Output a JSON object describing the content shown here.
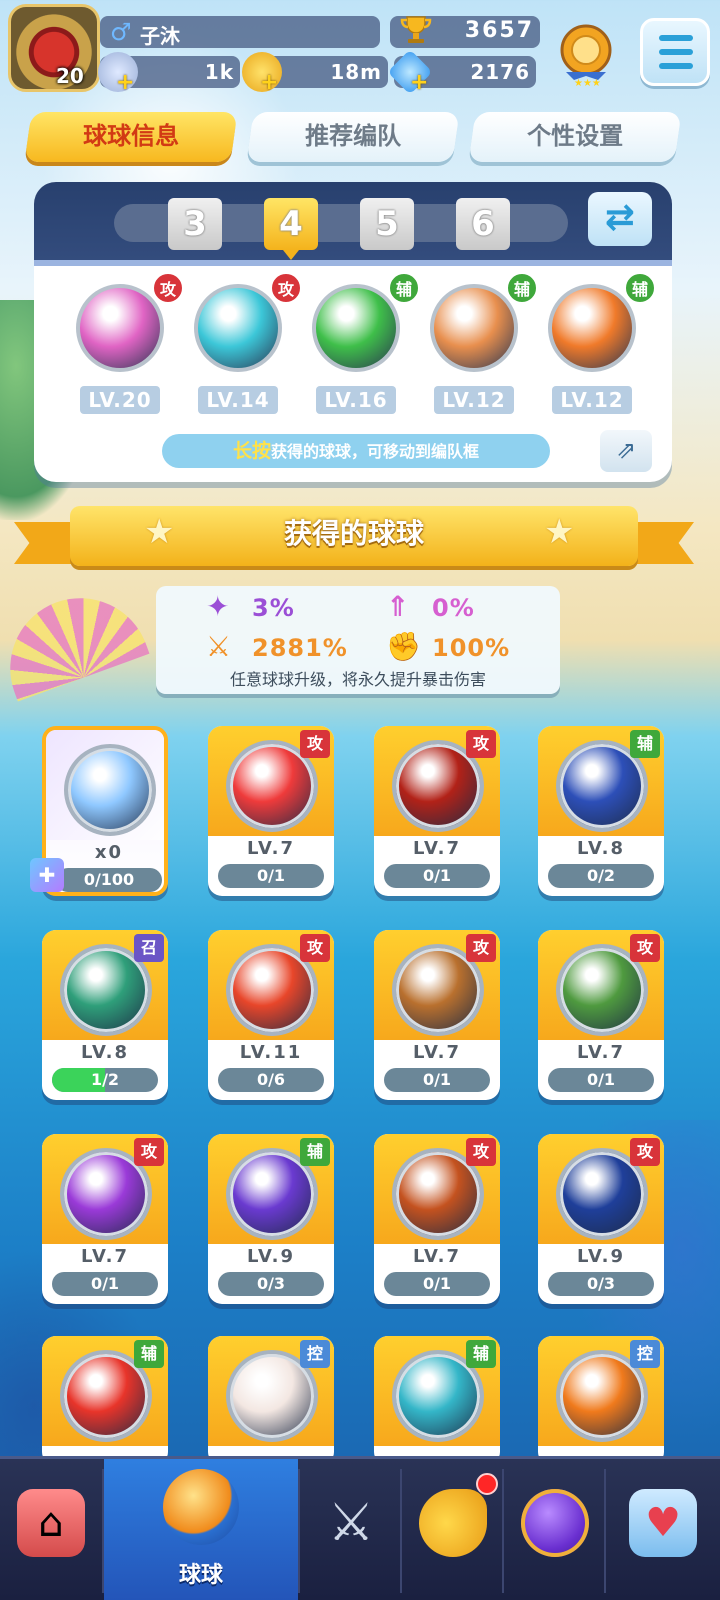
{
  "player": {
    "level": "20",
    "gender_icon": "male-icon",
    "name": "子沐",
    "trophies": "3657"
  },
  "resources": [
    {
      "icon": "star-energy-icon",
      "value": "1k"
    },
    {
      "icon": "gold-coin-icon",
      "value": "18m"
    },
    {
      "icon": "diamond-icon",
      "value": "2176"
    }
  ],
  "tabs": [
    {
      "label": "球球信息",
      "active": true
    },
    {
      "label": "推荐编队",
      "active": false
    },
    {
      "label": "个性设置",
      "active": false
    }
  ],
  "team": {
    "slots": [
      "3",
      "4",
      "5",
      "6"
    ],
    "active_slot": "4",
    "balls": [
      {
        "tag": "攻",
        "level": "LV.20",
        "color": "#e064c4"
      },
      {
        "tag": "攻",
        "level": "LV.14",
        "color": "#3cc7d8"
      },
      {
        "tag": "辅",
        "level": "LV.16",
        "color": "#3fbf4a"
      },
      {
        "tag": "辅",
        "level": "LV.12",
        "color": "#e88f4e"
      },
      {
        "tag": "辅",
        "level": "LV.12",
        "color": "#f07a2a"
      }
    ],
    "hint_highlight": "长按",
    "hint_text": "获得的球球，可移动到编队框"
  },
  "section_title": "获得的球球",
  "stats": {
    "items": [
      {
        "icon": "crit-rate-icon",
        "value": "3%",
        "color": "#9b4fd6"
      },
      {
        "icon": "crit-boost-icon",
        "value": "0%",
        "color": "#d65fd0"
      },
      {
        "icon": "crit-damage-icon",
        "value": "2881%",
        "color": "#f0922a"
      },
      {
        "icon": "power-icon",
        "value": "100%",
        "color": "#ec6a2a"
      }
    ],
    "note": "任意球球升级，将永久提升暴击伤害"
  },
  "cards": [
    {
      "special": true,
      "tag": "",
      "level": "x0",
      "progress": "0/100",
      "fill": 0,
      "color": "#8fc8ff"
    },
    {
      "tag": "攻",
      "level": "LV.7",
      "progress": "0/1",
      "fill": 0,
      "color": "#ef3b3b"
    },
    {
      "tag": "攻",
      "level": "LV.7",
      "progress": "0/1",
      "fill": 0,
      "color": "#b22218"
    },
    {
      "tag": "辅",
      "level": "LV.8",
      "progress": "0/2",
      "fill": 0,
      "color": "#2d4fb8"
    },
    {
      "tag": "召",
      "level": "LV.8",
      "progress": "1/2",
      "fill": 0.5,
      "color": "#2f9f7a"
    },
    {
      "tag": "攻",
      "level": "LV.11",
      "progress": "0/6",
      "fill": 0,
      "color": "#e8462a"
    },
    {
      "tag": "攻",
      "level": "LV.7",
      "progress": "0/1",
      "fill": 0,
      "color": "#b9702e"
    },
    {
      "tag": "攻",
      "level": "LV.7",
      "progress": "0/1",
      "fill": 0,
      "color": "#4f9a3f"
    },
    {
      "tag": "攻",
      "level": "LV.7",
      "progress": "0/1",
      "fill": 0,
      "color": "#9a3ad8"
    },
    {
      "tag": "辅",
      "level": "LV.9",
      "progress": "0/3",
      "fill": 0,
      "color": "#6a3ad0"
    },
    {
      "tag": "攻",
      "level": "LV.7",
      "progress": "0/1",
      "fill": 0,
      "color": "#c4521f"
    },
    {
      "tag": "攻",
      "level": "LV.9",
      "progress": "0/3",
      "fill": 0,
      "color": "#1f3f9a"
    },
    {
      "tag": "辅",
      "level": "",
      "progress": "",
      "fill": 0,
      "color": "#e8342a"
    },
    {
      "tag": "控",
      "level": "",
      "progress": "",
      "fill": 0,
      "color": "#f3e7e2"
    },
    {
      "tag": "辅",
      "level": "",
      "progress": "",
      "fill": 0,
      "color": "#34b6c8"
    },
    {
      "tag": "控",
      "level": "",
      "progress": "",
      "fill": 0,
      "color": "#f07a1c"
    }
  ],
  "nav": [
    {
      "icon": "shop-icon",
      "label": ""
    },
    {
      "icon": "ball-icon",
      "label": "球球",
      "active": true
    },
    {
      "icon": "crossed-swords-icon",
      "label": ""
    },
    {
      "icon": "whistle-icon",
      "label": "",
      "badge": true
    },
    {
      "icon": "planet-icon",
      "label": ""
    },
    {
      "icon": "chat-heart-icon",
      "label": ""
    }
  ]
}
